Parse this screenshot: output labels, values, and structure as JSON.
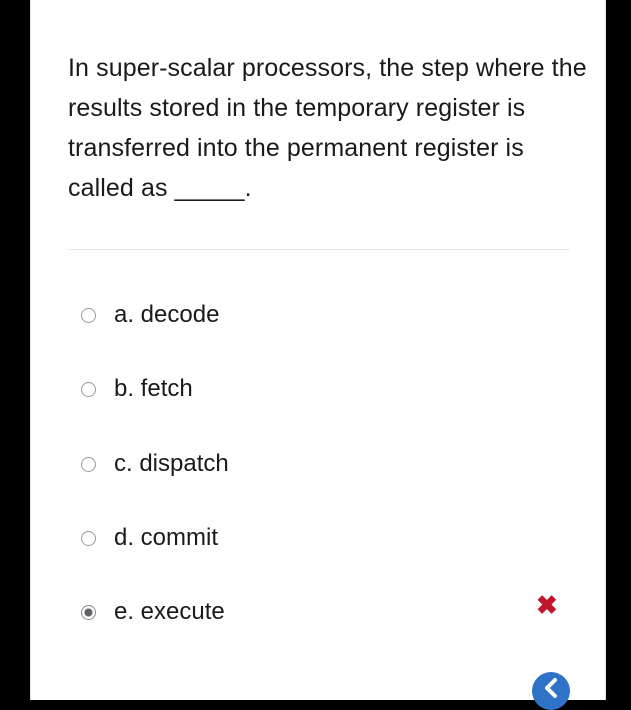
{
  "question": {
    "text": "In super-scalar processors, the step where the results stored in the temporary register is transferred into the permanent register is called as _____."
  },
  "options": [
    {
      "label": "a. decode",
      "selected": false
    },
    {
      "label": "b. fetch",
      "selected": false
    },
    {
      "label": "c. dispatch",
      "selected": false
    },
    {
      "label": "d. commit",
      "selected": false
    },
    {
      "label": "e. execute",
      "selected": true
    }
  ],
  "feedback": {
    "icon": "incorrect-x-icon",
    "color": "#c0182a"
  },
  "colors": {
    "accent": "#2f73c8",
    "text": "#1a1a1a"
  }
}
